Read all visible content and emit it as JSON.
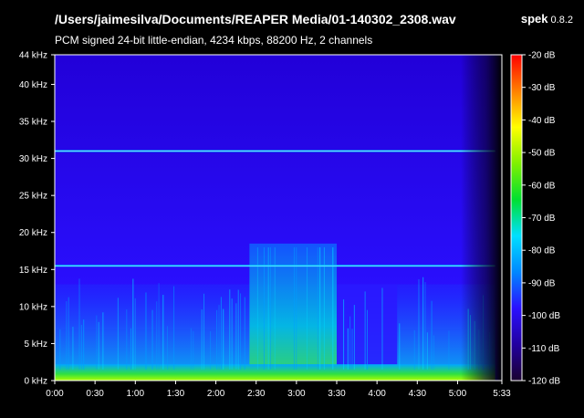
{
  "header": {
    "file_path": "/Users/jaimesilva/Documents/REAPER Media/01-140302_2308.wav",
    "file_info": "PCM signed 24-bit little-endian, 4234 kbps, 88200 Hz, 2 channels",
    "app_name": "spek",
    "app_version": "0.8.2"
  },
  "chart_data": {
    "type": "heatmap",
    "title": "/Users/jaimesilva/Documents/REAPER Media/01-140302_2308.wav",
    "xlabel": "",
    "ylabel": "",
    "x_ticks": [
      "0:00",
      "0:30",
      "1:00",
      "1:30",
      "2:00",
      "2:30",
      "3:00",
      "3:30",
      "4:00",
      "4:30",
      "5:00",
      "5:33"
    ],
    "x_tick_seconds": [
      0,
      30,
      60,
      90,
      120,
      150,
      180,
      210,
      240,
      270,
      300,
      333
    ],
    "x_range_seconds": [
      0,
      333
    ],
    "y_ticks": [
      "0 kHz",
      "5 kHz",
      "10 kHz",
      "15 kHz",
      "20 kHz",
      "25 kHz",
      "30 kHz",
      "35 kHz",
      "40 kHz",
      "44 kHz"
    ],
    "y_tick_khz": [
      0,
      5,
      10,
      15,
      20,
      25,
      30,
      35,
      40,
      44
    ],
    "y_range_khz": [
      0,
      44
    ],
    "colorbar_ticks": [
      "-20 dB",
      "-30 dB",
      "-40 dB",
      "-50 dB",
      "-60 dB",
      "-70 dB",
      "-80 dB",
      "-90 dB",
      "-100 dB",
      "-110 dB",
      "-120 dB"
    ],
    "colorbar_db": [
      -20,
      -30,
      -40,
      -50,
      -60,
      -70,
      -80,
      -90,
      -100,
      -110,
      -120
    ],
    "colorbar_range_db": [
      -120,
      -20
    ],
    "colormap": [
      "#1a0030",
      "#2200a0",
      "#2a10ff",
      "#0088ff",
      "#00e0ff",
      "#00e030",
      "#80f000",
      "#ffff00",
      "#ff8000",
      "#ff0000"
    ],
    "features": {
      "tonal_lines_khz": [
        31,
        15.5
      ],
      "dense_segment_seconds": [
        145,
        210
      ]
    }
  }
}
